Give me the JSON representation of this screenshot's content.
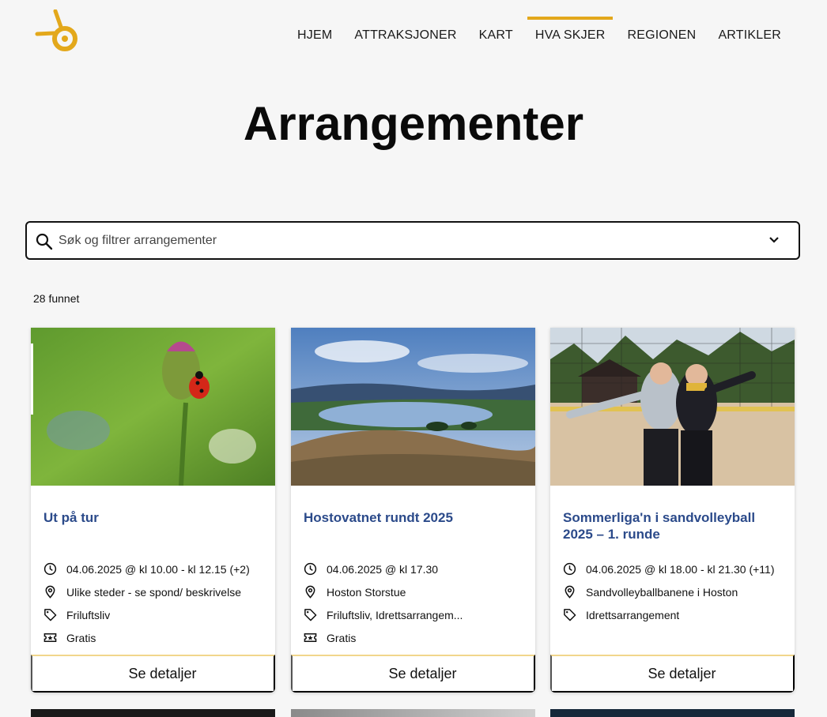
{
  "nav": {
    "items": [
      {
        "label": "HJEM"
      },
      {
        "label": "ATTRAKSJONER"
      },
      {
        "label": "KART"
      },
      {
        "label": "HVA SKJER"
      },
      {
        "label": "REGIONEN"
      },
      {
        "label": "ARTIKLER"
      }
    ],
    "active": "HVA SKJER"
  },
  "page": {
    "title": "Arrangementer"
  },
  "search": {
    "placeholder": "Søk og filtrer arrangementer"
  },
  "results": {
    "count_label": "28 funnet"
  },
  "cards": [
    {
      "title": "Ut på tur",
      "datetime": "04.06.2025 @ kl 10.00 - kl 12.15 (+2)",
      "location": "Ulike steder - se spond/ beskrivelse",
      "category": "Friluftsliv",
      "price": "Gratis",
      "button": "Se detaljer",
      "image": "ladybug-on-flower-bud"
    },
    {
      "title": "Hostovatnet rundt 2025",
      "datetime": "04.06.2025 @ kl 17.30",
      "location": "Hoston Storstue",
      "category": "Friluftsliv, Idrettsarrangem...",
      "price": "Gratis",
      "button": "Se detaljer",
      "image": "lake-landscape-view"
    },
    {
      "title": "Sommerliga'n i sandvolleyball 2025 – 1. runde",
      "datetime": "04.06.2025 @ kl 18.00 - kl 21.30 (+11)",
      "location": "Sandvolleyballbanene i Hoston",
      "category": "Idrettsarrangement",
      "button": "Se detaljer",
      "image": "two-women-beach-volleyball-court"
    }
  ],
  "colors": {
    "accent": "#e3a81b",
    "title_blue": "#2b4a8a",
    "background": "#f6f6f6"
  }
}
